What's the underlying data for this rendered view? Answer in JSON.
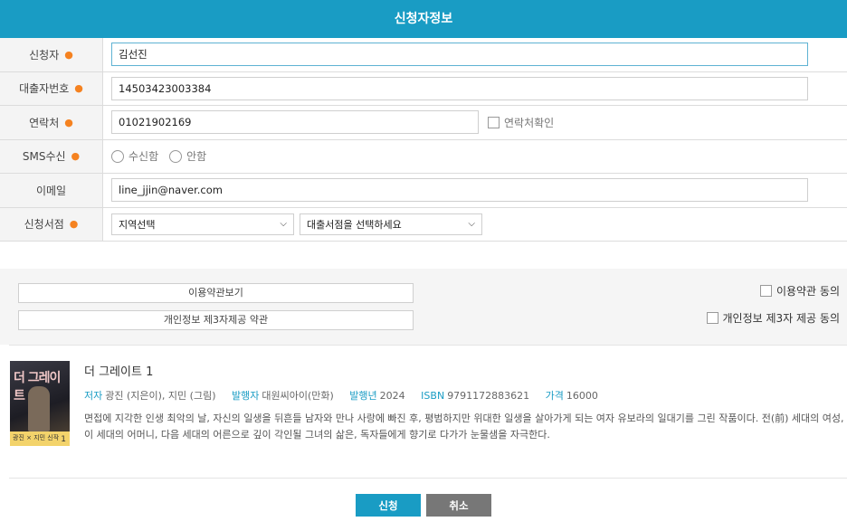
{
  "header": {
    "title": "신청자정보"
  },
  "form": {
    "applicant": {
      "label": "신청자",
      "value": "김선진"
    },
    "card_number": {
      "label": "대출자번호",
      "value": "14503423003384"
    },
    "contact": {
      "label": "연락처",
      "value": "01021902169",
      "confirm_label": "연락처확인"
    },
    "sms": {
      "label": "SMS수신",
      "opt_yes": "수신함",
      "opt_no": "안함"
    },
    "email": {
      "label": "이메일",
      "value": "line_jjin@naver.com"
    },
    "store": {
      "label": "신청서점",
      "region_selected": "지역선택",
      "store_selected": "대출서점을 선택하세요"
    },
    "required_mark": "●"
  },
  "terms": {
    "view_terms_btn": "이용약관보기",
    "privacy_btn": "개인정보 제3자제공 약관",
    "agree_terms": "이용약관 동의",
    "agree_privacy": "개인정보 제3자 제공 동의"
  },
  "book": {
    "title": "더 그레이트 1",
    "author_key": "저자",
    "author": "광진 (지은이), 지민 (그림)",
    "publisher_key": "발행자",
    "publisher": "대원씨아이(만화)",
    "year_key": "발행년",
    "year": "2024",
    "isbn_key": "ISBN",
    "isbn": "9791172883621",
    "price_key": "가격",
    "price": "16000",
    "description": "면접에 지각한 인생 최악의 날, 자신의 일생을 뒤흔들 남자와 만나 사랑에 빠진 후, 평범하지만 위대한 일생을 살아가게 되는 여자 유보라의 일대기를 그린 작품이다. 전(前) 세대의 여성, 이 세대의 어머니, 다음 세대의 어른으로 깊이 각인될 그녀의 삶은, 독자들에게 향기로 다가가 눈물샘을 자극한다.",
    "cover": {
      "title_text": "더 그레이트",
      "band_text": "광진 × 지민 신작",
      "number": "1"
    }
  },
  "actions": {
    "submit": "신청",
    "cancel": "취소"
  },
  "colors": {
    "accent": "#199cc4",
    "required": "#f58220",
    "cancel": "#777777"
  }
}
